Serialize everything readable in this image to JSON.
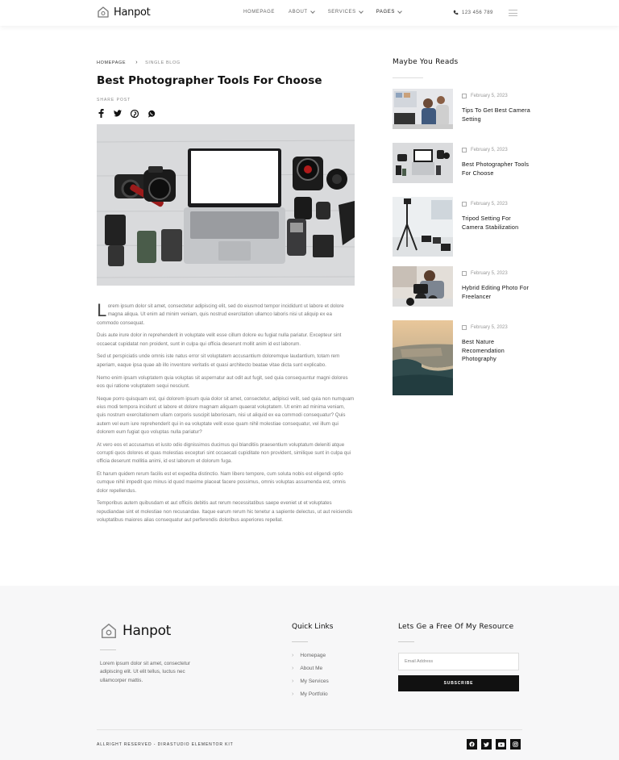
{
  "brand": {
    "name": "Hanpot"
  },
  "nav": {
    "items": [
      {
        "label": "Homepage"
      },
      {
        "label": "About"
      },
      {
        "label": "Services"
      },
      {
        "label": "Pages"
      }
    ],
    "phone": "123 456 789",
    "menu_icon": "hamburger-icon"
  },
  "breadcrumb": {
    "home": "Homepage",
    "current": "Single Blog"
  },
  "post": {
    "title": "Best Photographer Tools For Choose",
    "share_label": "Share Post",
    "share_icons": [
      "facebook-icon",
      "twitter-icon",
      "pinterest-icon",
      "whatsapp-icon"
    ],
    "dropcap": "L",
    "paragraphs": [
      "orem ipsum dolor sit amet, consectetur adipiscing elit, sed do eiusmod tempor incididunt ut labore et dolore magna aliqua. Ut enim ad minim veniam, quis nostrud exercitation ullamco laboris nisi ut aliquip ex ea commodo consequat.",
      "Duis aute irure dolor in reprehenderit in voluptate velit esse cillum dolore eu fugiat nulla pariatur. Excepteur sint occaecat cupidatat non proident, sunt in culpa qui officia deserunt mollit anim id est laborum.",
      "Sed ut perspiciatis unde omnis iste natus error sit voluptatem accusantium doloremque laudantium, totam rem aperiam, eaque ipsa quae ab illo inventore veritatis et quasi architecto beatae vitae dicta sunt explicabo.",
      "Nemo enim ipsam voluptatem quia voluptas sit aspernatur aut odit aut fugit, sed quia consequuntur magni dolores eos qui ratione voluptatem sequi nesciunt.",
      "Neque porro quisquam est, qui dolorem ipsum quia dolor sit amet, consectetur, adipisci velit, sed quia non numquam eius modi tempora incidunt ut labore et dolore magnam aliquam quaerat voluptatem. Ut enim ad minima veniam, quis nostrum exercitationem ullam corporis suscipit laboriosam, nisi ut aliquid ex ea commodi consequatur? Quis autem vel eum iure reprehenderit qui in ea voluptate velit esse quam nihil molestiae consequatur, vel illum qui dolorem eum fugiat quo voluptas nulla pariatur?",
      "At vero eos et accusamus et iusto odio dignissimos ducimus qui blanditiis praesentium voluptatum deleniti atque corrupti quos dolores et quas molestias excepturi sint occaecati cupiditate non provident, similique sunt in culpa qui officia deserunt mollitia animi, id est laborum et dolorum fuga.",
      "Et harum quidem rerum facilis est et expedita distinctio. Nam libero tempore, cum soluta nobis est eligendi optio cumque nihil impedit quo minus id quod maxime placeat facere possimus, omnis voluptas assumenda est, omnis dolor repellendus.",
      "Temporibus autem quibusdam et aut officiis debitis aut rerum necessitatibus saepe eveniet ut et voluptates repudiandae sint et molestiae non recusandae. Itaque earum rerum hic tenetur a sapiente delectus, ut aut reiciendis voluptatibus maiores alias consequatur aut perferendis doloribus asperiores repellat."
    ]
  },
  "sidebar": {
    "title": "Maybe You Reads",
    "items": [
      {
        "date": "February 5, 2023",
        "title": "Tips To Get Best Camera Setting"
      },
      {
        "date": "February 5, 2023",
        "title": "Best Photographer Tools For Choose"
      },
      {
        "date": "February 5, 2023",
        "title": "Tripod Setting For Camera Stabilization"
      },
      {
        "date": "February 5, 2023",
        "title": "Hybrid Editing Photo For Freelancer"
      },
      {
        "date": "February 5, 2023",
        "title": "Best Nature Recomendation Photography"
      }
    ]
  },
  "footer": {
    "brand": "Hanpot",
    "description": "Lorem ipsum dolor sit amet, consectetur adipiscing elit. Ut elit tellus, luctus nec ullamcorper mattis.",
    "quick_links_title": "Quick Links",
    "quick_links": [
      "Homepage",
      "About Me",
      "My Services",
      "My Portfolio"
    ],
    "newsletter_title": "Lets Ge a Free Of My Resource",
    "email_placeholder": "Email Address",
    "subscribe_label": "Subscribe",
    "copyright": "Allright Reserved - Dirastudio Elementor Kit",
    "socials": [
      "facebook-icon",
      "twitter-icon",
      "youtube-icon",
      "instagram-icon"
    ]
  },
  "colors": {
    "accent": "#111111",
    "footer_bg": "#f7f7f8",
    "text_muted": "#777777"
  }
}
